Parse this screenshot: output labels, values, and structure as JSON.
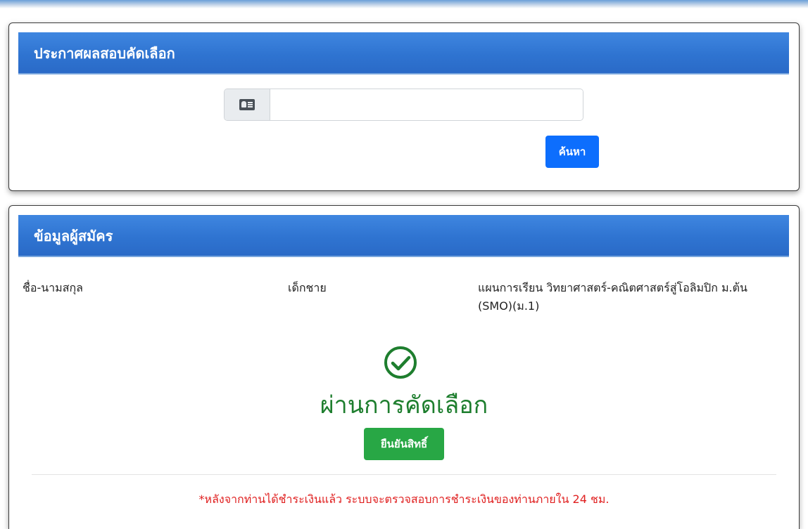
{
  "search_card": {
    "title": "ประกาศผลสอบคัดเลือก",
    "id_input": {
      "value": "",
      "placeholder": ""
    },
    "icon": "id-card-icon",
    "search_button": "ค้นหา"
  },
  "applicant_card": {
    "title": "ข้อมูลผู้สมัคร",
    "name_label": "ชื่อ-นามสกุล",
    "gender": "เด็กชาย",
    "plan": "แผนการเรียน วิทยาศาสตร์-คณิตศาสตร์สู่โอลิมปิก ม.ต้น (SMO)(ม.1)",
    "status_icon": "check-circle-icon",
    "result": "ผ่านการคัดเลือก",
    "confirm_button": "ยืนยันสิทธิ์",
    "note": "*หลังจากท่านได้ชำระเงินแล้ว ระบบจะตรวจสอบการชำระเงินของท่านภายใน 24 ชม."
  },
  "colors": {
    "header": "#2f74d1",
    "primary_button": "#0d6efd",
    "success": "#28a745",
    "result_text": "#1e7e2e",
    "note_text": "#e02020"
  }
}
